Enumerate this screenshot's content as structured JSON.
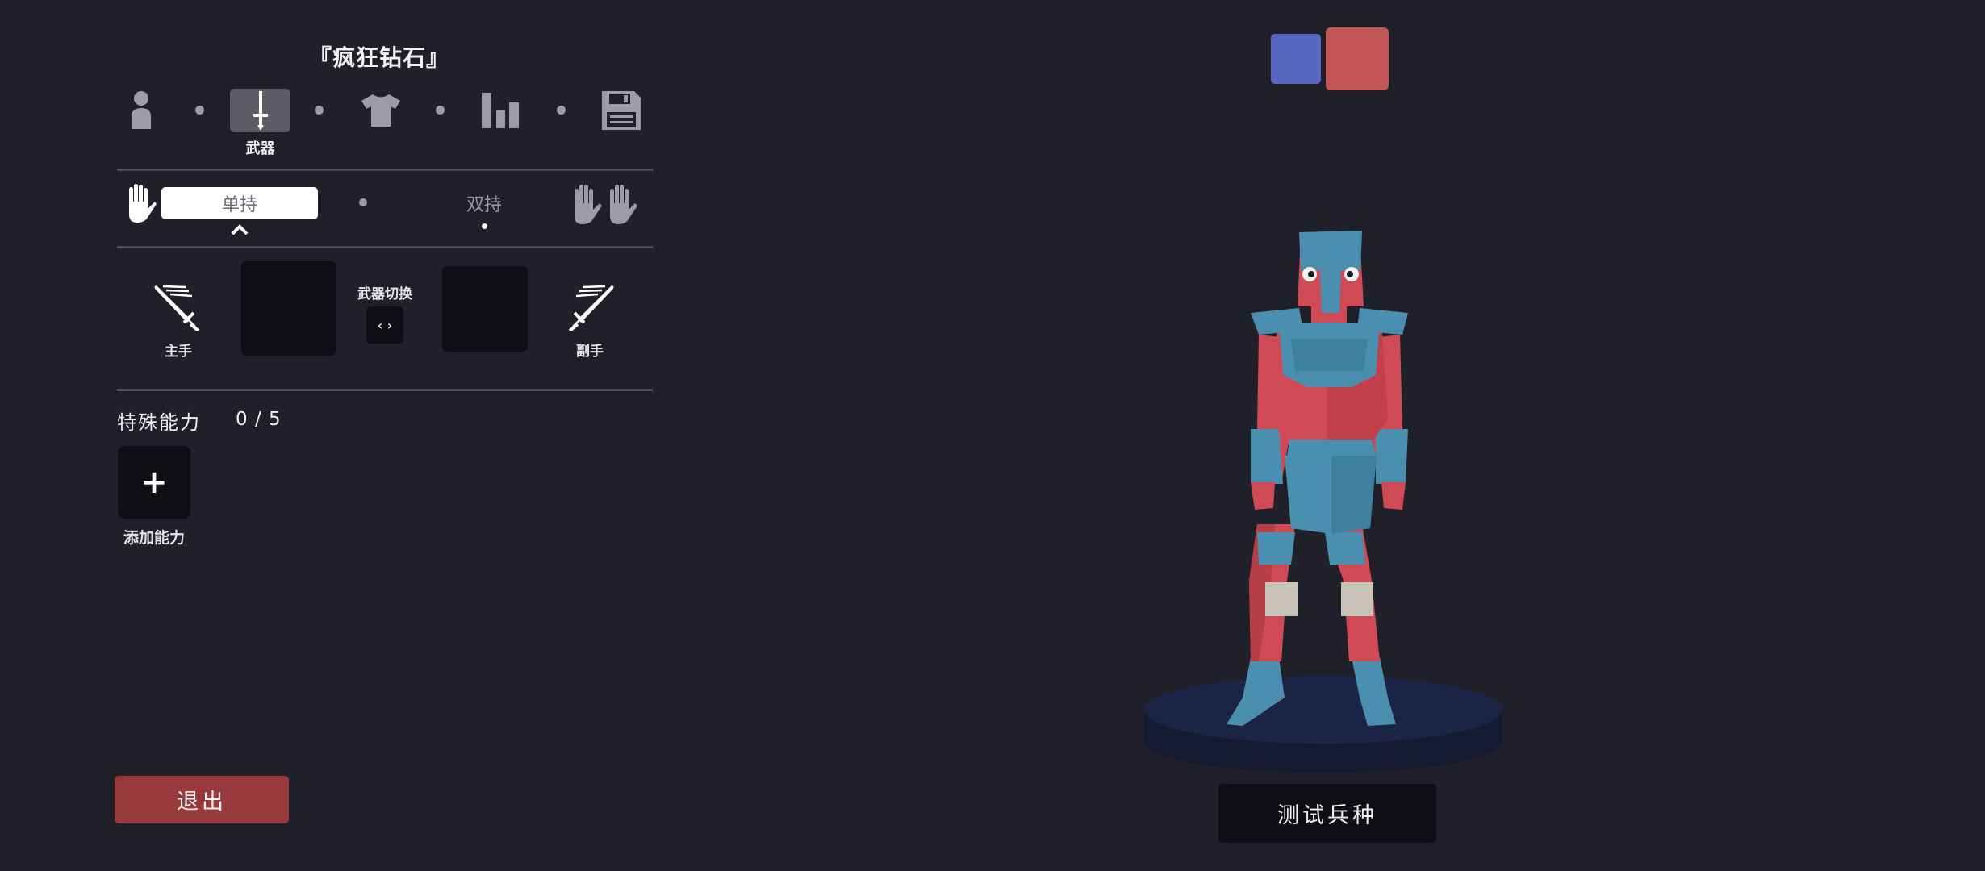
{
  "unit_name": "『疯狂钻石』",
  "tabs": [
    {
      "name": "unit-base",
      "icon": "person-icon"
    },
    {
      "name": "weapons",
      "icon": "sword-icon",
      "label": "武器",
      "active": true
    },
    {
      "name": "clothing",
      "icon": "shirt-icon"
    },
    {
      "name": "stats",
      "icon": "bar-chart-icon"
    },
    {
      "name": "save",
      "icon": "floppy-disk-icon"
    }
  ],
  "grip": {
    "one_handed": "单持",
    "two_handed": "双持",
    "selected": "one_handed"
  },
  "weapons": {
    "main_hand_label": "主手",
    "off_hand_label": "副手",
    "switch_label": "武器切换",
    "switch_glyph": "‹ ›"
  },
  "special": {
    "label": "特殊能力",
    "count": "0 / 5",
    "add_symbol": "+",
    "add_label": "添加能力"
  },
  "exit_label": "退出",
  "test_label": "测试兵种",
  "colors": {
    "background": "#20202b",
    "team_blue": "#5868c2",
    "team_red": "#c45557",
    "exit_button": "#983a3c",
    "armor_blue": "#4a8fb0",
    "armor_red": "#d04a55"
  }
}
